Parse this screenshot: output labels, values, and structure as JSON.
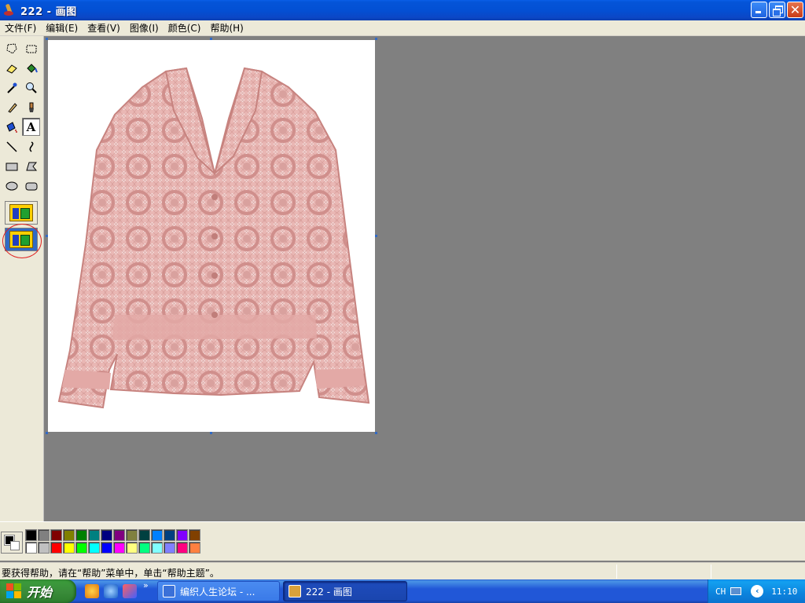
{
  "window": {
    "title": "222 - 画图"
  },
  "menu": [
    {
      "label": "文件(F)"
    },
    {
      "label": "编辑(E)"
    },
    {
      "label": "查看(V)"
    },
    {
      "label": "图像(I)"
    },
    {
      "label": "颜色(C)"
    },
    {
      "label": "帮助(H)"
    }
  ],
  "tools": [
    {
      "name": "free-form-select-icon"
    },
    {
      "name": "rect-select-icon"
    },
    {
      "name": "eraser-icon"
    },
    {
      "name": "fill-bucket-icon"
    },
    {
      "name": "pick-color-icon"
    },
    {
      "name": "magnifier-icon"
    },
    {
      "name": "pencil-icon"
    },
    {
      "name": "brush-icon"
    },
    {
      "name": "airbrush-icon"
    },
    {
      "name": "text-icon",
      "glyph": "A",
      "active": true
    },
    {
      "name": "line-icon"
    },
    {
      "name": "curve-icon"
    },
    {
      "name": "rectangle-icon"
    },
    {
      "name": "polygon-icon"
    },
    {
      "name": "ellipse-icon"
    },
    {
      "name": "rounded-rect-icon"
    }
  ],
  "canvas": {
    "image_subject": "pink crochet lace cardigan"
  },
  "palette": {
    "foreground": "#000000",
    "background": "#ffffff",
    "row1": [
      "#000000",
      "#808080",
      "#800000",
      "#808000",
      "#008000",
      "#008080",
      "#000080",
      "#800080",
      "#808040",
      "#004040",
      "#0080ff",
      "#004080",
      "#8000ff",
      "#804000"
    ],
    "row2": [
      "#ffffff",
      "#c0c0c0",
      "#ff0000",
      "#ffff00",
      "#00ff00",
      "#00ffff",
      "#0000ff",
      "#ff00ff",
      "#ffff80",
      "#00ff80",
      "#80ffff",
      "#8080ff",
      "#ff0080",
      "#ff8040"
    ]
  },
  "status": {
    "text": "要获得帮助，请在“帮助”菜单中，单击“帮助主题”。"
  },
  "taskbar": {
    "start_label": "开始",
    "quick_more": "»",
    "tasks": [
      {
        "label": "编织人生论坛 - ...",
        "active": false
      },
      {
        "label": "222 - 画图",
        "active": true
      }
    ],
    "tray_lang": "CH",
    "tray_chevron": "‹",
    "clock": "11:10"
  }
}
